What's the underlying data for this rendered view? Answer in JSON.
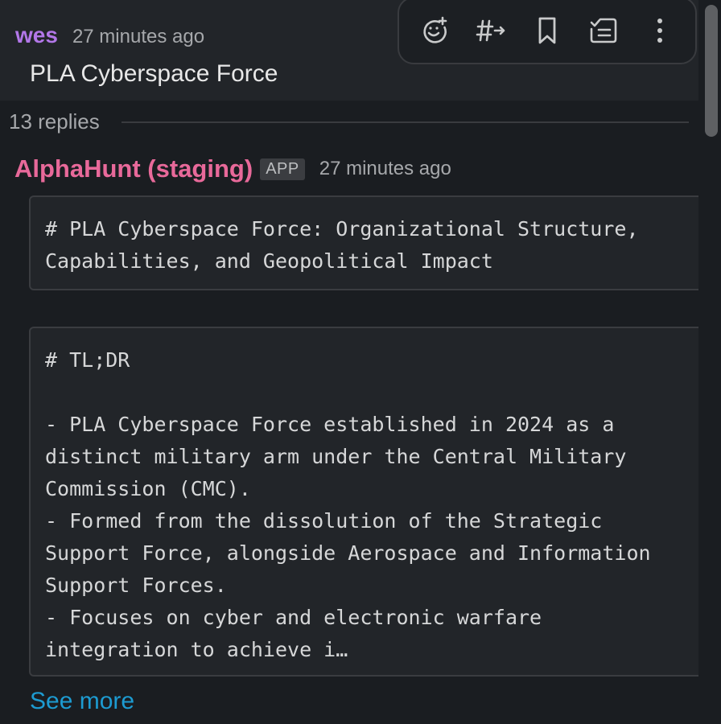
{
  "parent_message": {
    "author": "wes",
    "timestamp": "27 minutes ago",
    "text": "PLA Cyberspace Force",
    "author_color": "#b277e8"
  },
  "toolbar": {
    "icons": [
      "add-reaction-icon",
      "reply-in-channel-icon",
      "bookmark-icon",
      "move-to-list-icon",
      "more-actions-icon"
    ]
  },
  "thread": {
    "replies_count": "13 replies"
  },
  "reply": {
    "author": "AlphaHunt (staging)",
    "badge": "APP",
    "timestamp": "27 minutes ago",
    "author_color": "#e8699a",
    "code_block_1": "# PLA Cyberspace Force: Organizational Structure,\nCapabilities, and Geopolitical Impact",
    "code_block_2": "# TL;DR\n\n- PLA Cyberspace Force established in 2024 as a\ndistinct military arm under the Central Military\nCommission (CMC).\n- Formed from the dissolution of the Strategic\nSupport Force, alongside Aerospace and Information\nSupport Forces.\n- Focuses on cyber and electronic warfare\nintegration to achieve i…",
    "see_more": "See more"
  },
  "colors": {
    "background": "#1a1d21",
    "link": "#1d9bd1"
  }
}
